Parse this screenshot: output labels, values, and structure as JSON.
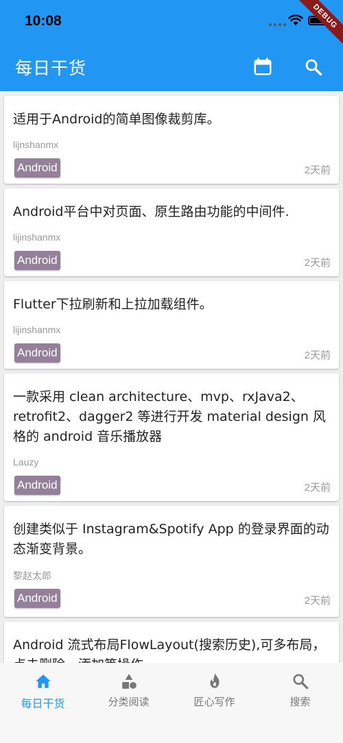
{
  "status_bar": {
    "time": "10:08"
  },
  "debug_banner": "DEBUG",
  "app_bar": {
    "title": "每日干货",
    "calendar_icon": "calendar-icon",
    "search_icon": "search-icon"
  },
  "articles": [
    {
      "title": "适用于Android的简单图像裁剪库。",
      "author": "lijnshanmx",
      "tag": "Android",
      "time": "2天前"
    },
    {
      "title": "Android平台中对页面、原生路由功能的中间件.",
      "author": "lijinshanmx",
      "tag": "Android",
      "time": "2天前"
    },
    {
      "title": "Flutter下拉刷新和上拉加载组件。",
      "author": "lijinshanmx",
      "tag": "Android",
      "time": "2天前"
    },
    {
      "title": "一款采用 clean architecture、mvp、rxJava2、retrofit2、dagger2 等进行开发 material design 风格的 android 音乐播放器",
      "author": "Lauzy",
      "tag": "Android",
      "time": "2天前"
    },
    {
      "title": "创建类似于 Instagram&Spotify App 的登录界面的动态渐变背景。",
      "author": "黎赵太郎",
      "tag": "Android",
      "time": "2天前"
    },
    {
      "title": "Android 流式布局FlowLayout(搜索历史),可多布局，点击删除，添加等操作"
    }
  ],
  "bottom_nav": [
    {
      "label": "每日干货",
      "icon": "home-icon",
      "active": true
    },
    {
      "label": "分类阅读",
      "icon": "category-icon",
      "active": false
    },
    {
      "label": "匠心写作",
      "icon": "fire-icon",
      "active": false
    },
    {
      "label": "搜索",
      "icon": "search-icon",
      "active": false
    }
  ],
  "colors": {
    "primary": "#2196F3",
    "tag_bg": "#95809a",
    "debug": "#8b1a1a"
  }
}
